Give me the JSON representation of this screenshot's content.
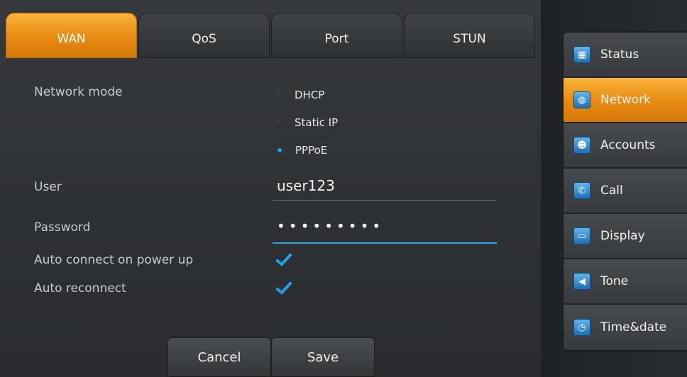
{
  "tabs": [
    {
      "label": "WAN",
      "active": true
    },
    {
      "label": "QoS",
      "active": false
    },
    {
      "label": "Port",
      "active": false
    },
    {
      "label": "STUN",
      "active": false
    }
  ],
  "form": {
    "network_mode_label": "Network mode",
    "modes": [
      {
        "label": "DHCP",
        "selected": false
      },
      {
        "label": "Static IP",
        "selected": false
      },
      {
        "label": "PPPoE",
        "selected": true
      }
    ],
    "user_label": "User",
    "user_value": "user123",
    "password_label": "Password",
    "password_value": "•••••••••",
    "auto_connect_label": "Auto connect on power up",
    "auto_connect_checked": true,
    "auto_reconnect_label": "Auto reconnect",
    "auto_reconnect_checked": true
  },
  "buttons": {
    "cancel": "Cancel",
    "save": "Save"
  },
  "sidebar": {
    "items": [
      {
        "label": "Status",
        "icon": "status-icon",
        "active": false
      },
      {
        "label": "Network",
        "icon": "globe-icon",
        "active": true
      },
      {
        "label": "Accounts",
        "icon": "accounts-icon",
        "active": false
      },
      {
        "label": "Call",
        "icon": "phone-icon",
        "active": false
      },
      {
        "label": "Display",
        "icon": "monitor-icon",
        "active": false
      },
      {
        "label": "Tone",
        "icon": "speaker-icon",
        "active": false
      },
      {
        "label": "Time&date",
        "icon": "clock-icon",
        "active": false
      }
    ]
  },
  "colors": {
    "accent": "#f39a1e",
    "focus": "#2aa7e2"
  }
}
